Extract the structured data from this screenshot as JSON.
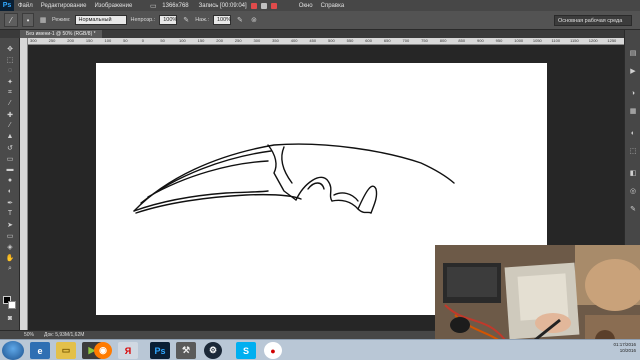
{
  "menubar": {
    "logo": "Ps",
    "items": [
      "Файл",
      "Редактирование",
      "Изображение"
    ],
    "items_right": [
      "Окно",
      "Справка"
    ],
    "resolution": "1366x768",
    "recording": "Запись [00:09:04]"
  },
  "options": {
    "mode_label": "Режим:",
    "mode_value": "Нормальный",
    "opacity_label": "Непрозр.:",
    "opacity_value": "100%",
    "pressure_label": "Наж.:",
    "pressure_value": "100%",
    "workspace": "Основная рабочая среда"
  },
  "document": {
    "tab_title": "Без имени-1 @ 50% (RGB/8) *",
    "zoom": "50%",
    "doc_info": "Док: 5,93M/1,62M"
  },
  "ruler": {
    "ticks": [
      "300",
      "250",
      "200",
      "150",
      "100",
      "50",
      "0",
      "50",
      "100",
      "150",
      "200",
      "250",
      "300",
      "350",
      "400",
      "450",
      "500",
      "550",
      "600",
      "650",
      "700",
      "750",
      "800",
      "850",
      "900",
      "950",
      "1000",
      "1050",
      "1100",
      "1150",
      "1200",
      "1250"
    ]
  },
  "taskbar": {
    "yandex_icon": "Я",
    "photoshop_icon": "Ps",
    "skype_icon": "S",
    "clock_time": "01:17/2016",
    "clock_date": "10/2016"
  },
  "colors": {
    "accent": "#31a8ff",
    "panel": "#535353",
    "canvas_bg": "#262626"
  }
}
